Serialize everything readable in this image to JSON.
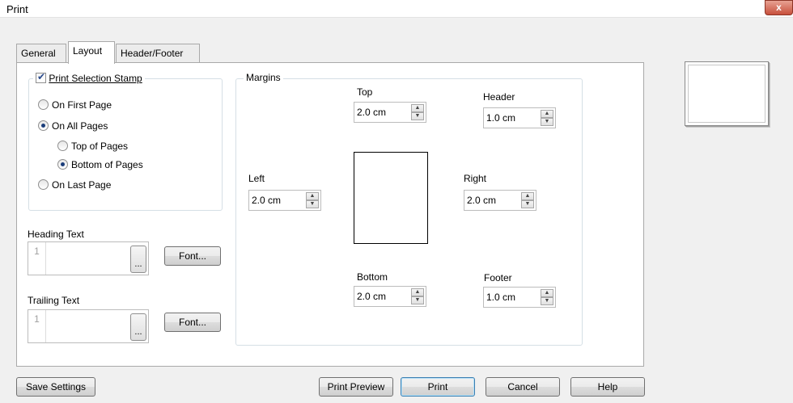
{
  "window": {
    "title": "Print",
    "close_label": "x"
  },
  "tabs": [
    {
      "label": "General"
    },
    {
      "label": "Layout"
    },
    {
      "label": "Header/Footer"
    }
  ],
  "stamp": {
    "label": "Print Selection Stamp",
    "checked": true,
    "options": {
      "first_page": "On First Page",
      "all_pages": "On All Pages",
      "top_of_pages": "Top of Pages",
      "bottom_of_pages": "Bottom of Pages",
      "last_page": "On Last Page"
    }
  },
  "heading_text": {
    "label": "Heading Text",
    "line_number": "1",
    "ellipsis": "...",
    "font_button": "Font..."
  },
  "trailing_text": {
    "label": "Trailing Text",
    "line_number": "1",
    "ellipsis": "...",
    "font_button": "Font..."
  },
  "margins": {
    "legend": "Margins",
    "top": {
      "label": "Top",
      "value": "2.0 cm"
    },
    "header": {
      "label": "Header",
      "value": "1.0 cm"
    },
    "left": {
      "label": "Left",
      "value": "2.0 cm"
    },
    "right": {
      "label": "Right",
      "value": "2.0 cm"
    },
    "bottom": {
      "label": "Bottom",
      "value": "2.0 cm"
    },
    "footer": {
      "label": "Footer",
      "value": "1.0 cm"
    }
  },
  "buttons": {
    "save_settings": "Save Settings",
    "print_preview": "Print Preview",
    "print": "Print",
    "cancel": "Cancel",
    "help": "Help"
  },
  "icons": {
    "spin_up": "spin-up-icon",
    "spin_down": "spin-down-icon",
    "close": "close-icon"
  }
}
